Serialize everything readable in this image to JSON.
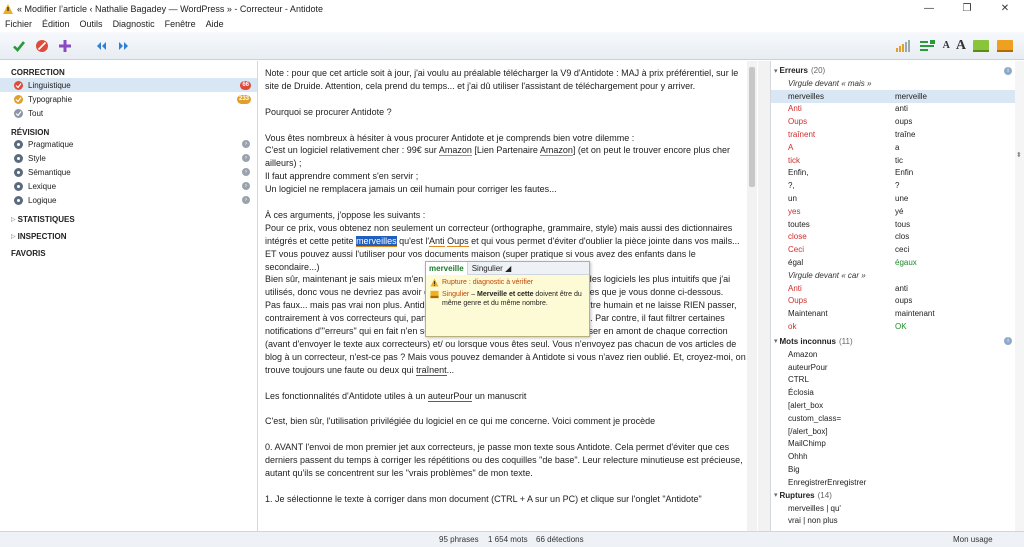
{
  "window": {
    "title": "« Modifier l’article ‹ Nathalie Bagadey — WordPress » - Correcteur - Antidote",
    "minimize": "—",
    "maximize": "❐",
    "close": "✕"
  },
  "menu": [
    "Fichier",
    "Édition",
    "Outils",
    "Diagnostic",
    "Fenêtre",
    "Aide"
  ],
  "toolbar": {
    "font_small": "A",
    "font_large": "A"
  },
  "sidebar": {
    "correction": {
      "title": "CORRECTION",
      "items": [
        {
          "label": "Linguistique",
          "badge": "66",
          "color": "#e04a3a"
        },
        {
          "label": "Typographie",
          "badge": "233",
          "color": "#e0a02a"
        },
        {
          "label": "Tout",
          "badge": ""
        }
      ]
    },
    "revision": {
      "title": "RÉVISION",
      "items": [
        {
          "label": "Pragmatique"
        },
        {
          "label": "Style"
        },
        {
          "label": "Sémantique"
        },
        {
          "label": "Lexique"
        },
        {
          "label": "Logique"
        }
      ]
    },
    "statistiques": "STATISTIQUES",
    "inspection": "INSPECTION",
    "favoris": "FAVORIS"
  },
  "main": {
    "p1": "Note : pour que cet article soit à jour, j'ai voulu au préalable télécharger la V9 d'Antidote : MAJ à prix préférentiel, sur le site de Druide. Attention, cela prend du temps... et j'ai dû utiliser l'assistant de téléchargement pour y arriver.",
    "p2": "Pourquoi se procurer Antidote ?",
    "p3a": "Vous êtes nombreux à hésiter à vous procurer Antidote et je comprends bien votre dilemme :",
    "p3b_pre": "C'est un logiciel relativement cher : 99€ sur ",
    "p3b_amazon1": "Amazon",
    "p3b_mid": " [Lien Partenaire ",
    "p3b_amazon2": "Amazon",
    "p3b_post": "] (et on peut le trouver encore plus cher ailleurs) ;",
    "p3c": "Il faut apprendre comment s'en servir ;",
    "p3d": "Un logiciel ne remplacera jamais un œil humain pour corriger les fautes...",
    "p4a": "À ces arguments, j'oppose les suivants :",
    "p4b": "Pour ce prix, vous obtenez non seulement un correcteur (orthographe, grammaire, style) mais aussi des dictionnaires intégrés et cette petite ",
    "p4b_hl": "merveilles",
    "p4b_post1": " qu'est l'",
    "p4b_anti": "Anti",
    "p4b_sp": " ",
    "p4b_oups": "Oups",
    "p4b_post2": " et qui vous permet d'éviter d'oublier la pièce jointe dans vos mails... ET vous pouvez aussi l'utiliser pour vos documents maison (super pratique si vous avez des enfants dans le secondaire...)",
    "p4c": "Bien sûr, maintenant je sais mieux m'en servir. Mais pour être honnête, c'est l'un des logiciels les plus intuitifs que j'ai utilisés, donc vous ne devriez pas avoir de mal à le maîtriser, surtout avec les pistes que je vous donne ci-dessous.",
    "p4d": "Pas faux... mais pas vrai non plus. Antidote est beaucoup plus performant qu'un être humain et ne laisse RIEN passer, contrairement à vos correcteurs qui, parfois, ne voient pas la faute ou la répétition. Par contre, il faut filtrer certaines notifications d'\"erreurs\" qui en fait n'en sont pas. Mais pour moi Antidote est à utiliser en amont de chaque correction (avant d'envoyer le texte aux correcteurs) et/ ou lorsque vous êtes seul. Vous n'envoyez pas chacun de vos articles de blog à un correcteur, n'est-ce pas ? Mais vous pouvez demander à Antidote si vous n'avez rien oublié. Et, croyez-moi, on trouve toujours une faute ou deux qui ",
    "p4d_err": "traînent",
    "p4d_end": "...",
    "p5_pre": "Les fonctionnalités d'Antidote utiles à un ",
    "p5_err": "auteurPour",
    "p5_post": " un manuscrit",
    "p6": "C'est, bien sûr, l'utilisation privilégiée du logiciel en ce qui me concerne. Voici comment je procède",
    "p7": "0. AVANT l'envoi de mon premier jet aux correcteurs, je passe mon texte sous Antidote. Cela permet d'éviter que ces derniers passent du temps à corriger les répétitions ou des coquilles \"de base\". Leur relecture minutieuse est précieuse, autant qu'ils se concentrent sur les \"vrais problèmes\" de mon texte.",
    "p8": "1. Je sélectionne le texte à corriger dans mon document (CTRL + A sur un PC) et clique sur l'onglet \"Antidote\""
  },
  "popup": {
    "word": "merveille",
    "tag": "Singulier",
    "rupture_label": "Rupture : diagnostic à vérifier",
    "singulier_label": "Singulier",
    "singulier_msg_pre": " – ",
    "singulier_bold": "Merveille et cette",
    "singulier_msg": " doivent être du même genre et du même nombre."
  },
  "errors_panel": {
    "errors": {
      "title": "Erreurs",
      "count": "(20)",
      "group1": "Virgule devant « mais »",
      "rows1": [
        [
          "merveilles",
          "merveille"
        ],
        [
          "Anti",
          "anti"
        ],
        [
          "Oups",
          "oups"
        ],
        [
          "traînent",
          "traîne"
        ],
        [
          "A",
          "a"
        ],
        [
          "tick",
          "tic"
        ],
        [
          "Enfin,",
          "Enfin"
        ],
        [
          "?,",
          "?"
        ],
        [
          "un",
          "une"
        ],
        [
          "yes",
          "yé"
        ],
        [
          "toutes",
          "tous"
        ],
        [
          "close",
          "clos"
        ],
        [
          "Ceci",
          "ceci"
        ],
        [
          "égal",
          "égaux"
        ]
      ],
      "group2": "Virgule devant « car »",
      "rows2": [
        [
          "Anti",
          "anti"
        ],
        [
          "Oups",
          "oups"
        ],
        [
          "Maintenant",
          "maintenant"
        ],
        [
          "ok",
          "OK"
        ]
      ]
    },
    "unknown": {
      "title": "Mots inconnus",
      "count": "(11)",
      "rows": [
        "Amazon",
        "auteurPour",
        "CTRL",
        "Éclosia",
        "[alert_box",
        "custom_class=",
        "[/alert_box]",
        "MailChimp",
        "Ohhh",
        "Big",
        "EnregistrerEnregistrer"
      ]
    },
    "ruptures": {
      "title": "Ruptures",
      "count": "(14)",
      "rows": [
        "merveilles | qu'",
        "vrai | non plus"
      ]
    }
  },
  "status": {
    "phrases": "95 phrases",
    "mots": "1 654 mots",
    "detections": "66 détections",
    "usage": "Mon usage"
  }
}
